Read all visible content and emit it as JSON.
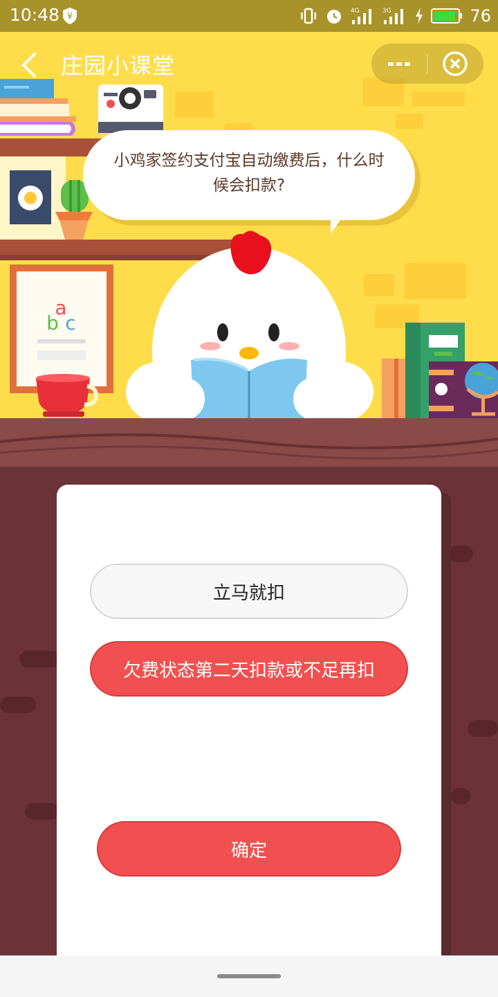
{
  "status_bar": {
    "time": "10:48",
    "battery": "76",
    "network_1": "4G",
    "network_2": "3G"
  },
  "nav": {
    "title": "庄园小课堂"
  },
  "quiz": {
    "question": "小鸡家签约支付宝自动缴费后，什么时候会扣款?",
    "options": [
      {
        "label": "立马就扣",
        "selected": false
      },
      {
        "label": "欠费状态第二天扣款或不足再扣",
        "selected": true
      }
    ],
    "confirm_label": "确定"
  },
  "decor": {
    "letters": [
      "a",
      "b",
      "c"
    ]
  },
  "colors": {
    "scene_bg": "#ffdd4a",
    "page_bg": "#6b3238",
    "accent_red": "#f25050",
    "status_bar": "#a8922a"
  }
}
